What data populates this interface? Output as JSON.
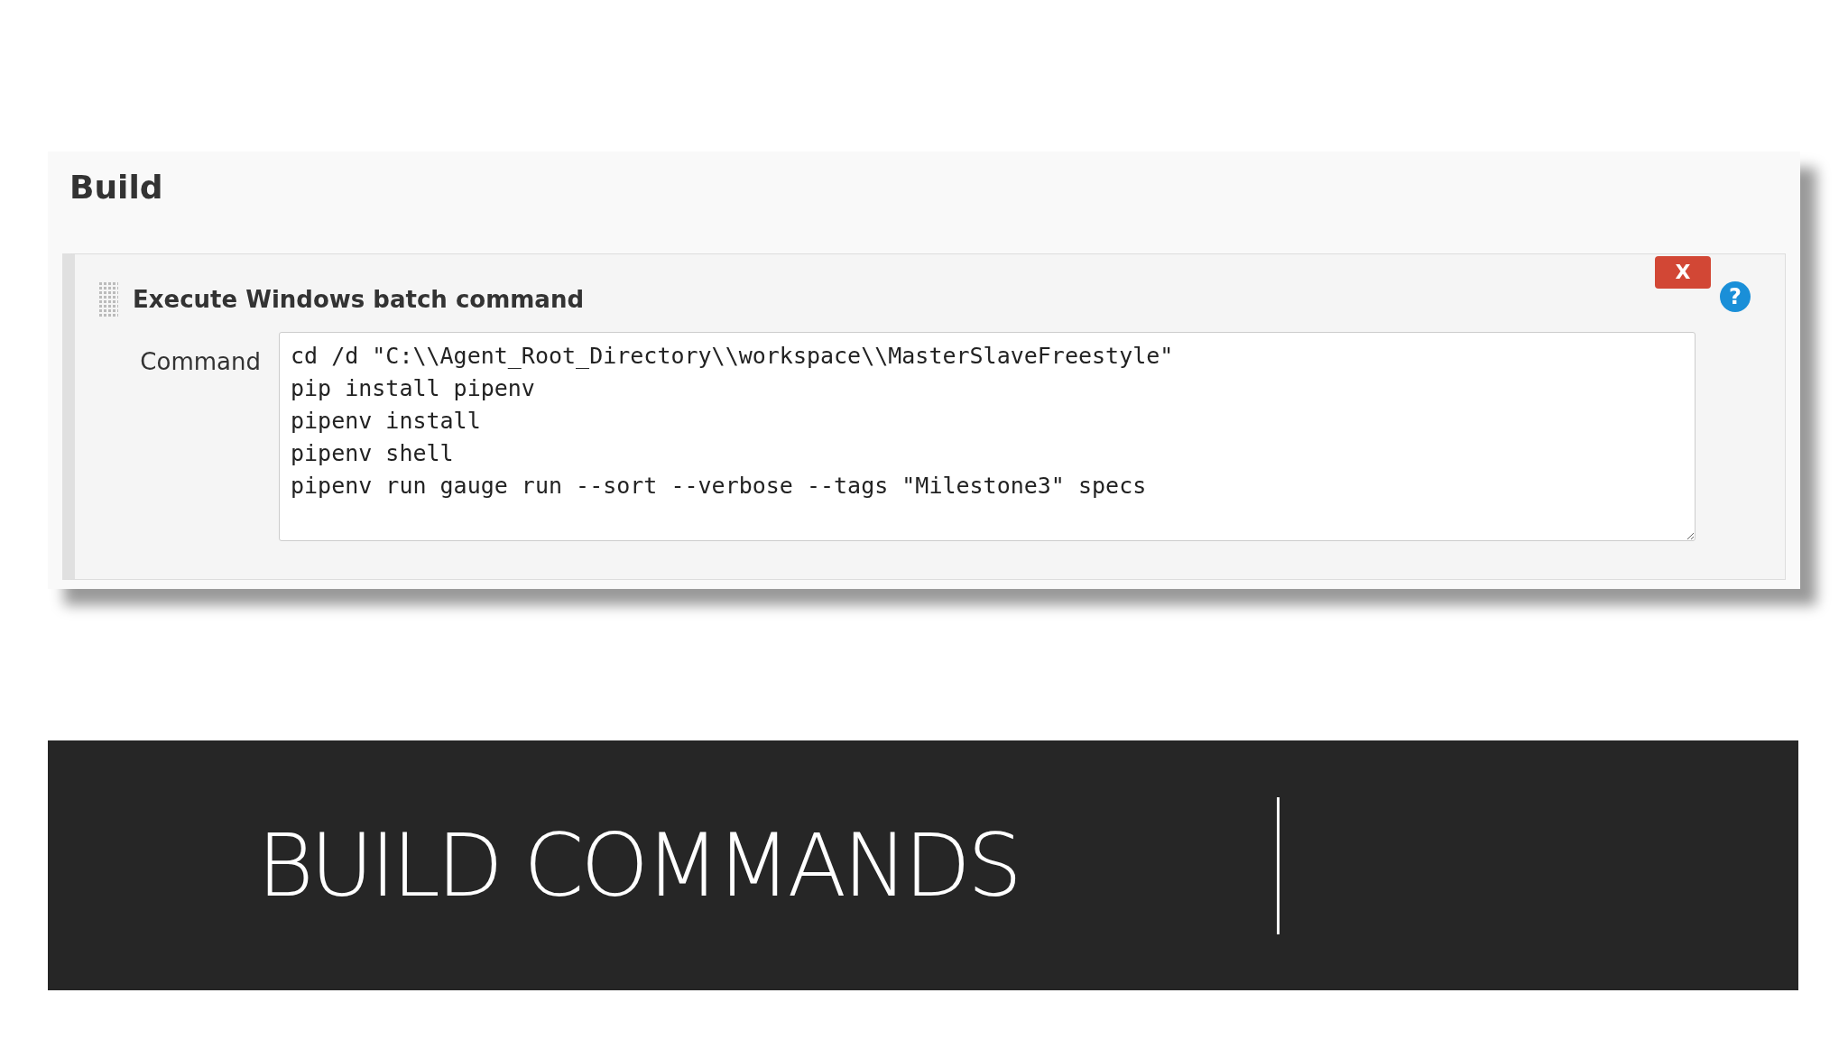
{
  "section": {
    "title": "Build"
  },
  "build_step": {
    "title": "Execute Windows batch command",
    "delete_label": "X",
    "help_label": "?",
    "field": {
      "label": "Command",
      "value": "cd /d \"C:\\\\Agent_Root_Directory\\\\workspace\\\\MasterSlaveFreestyle\"\npip install pipenv\npipenv install\npipenv shell\npipenv run gauge run --sort --verbose --tags \"Milestone3\" specs"
    }
  },
  "banner": {
    "title": "BUILD COMMANDS"
  }
}
